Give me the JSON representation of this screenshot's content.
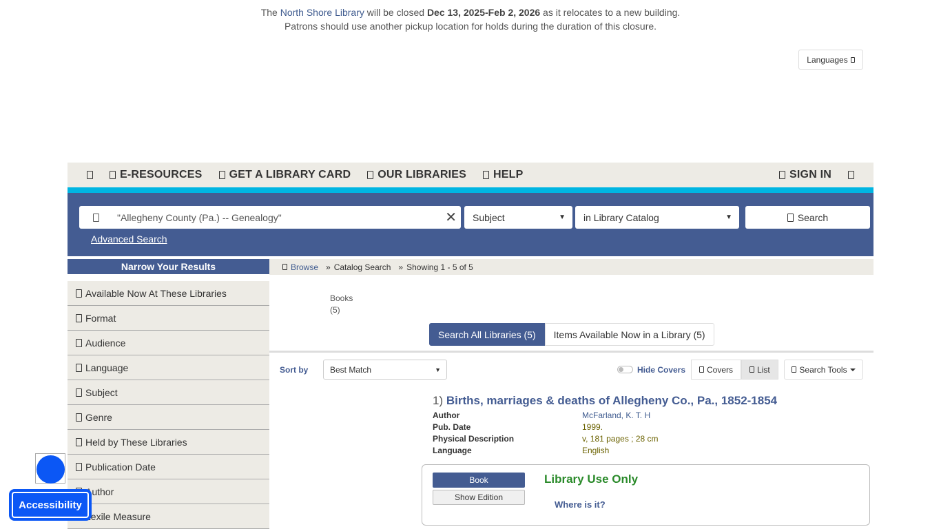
{
  "alert": {
    "line1_pre": "The ",
    "library_link": "North Shore Library",
    "line1_mid": " will be closed ",
    "dates": "Dec 13, 2025-Feb 2, 2026",
    "line1_post": " as it relocates to a new building.",
    "line2": "Patrons should use another pickup location for holds during the duration of this closure."
  },
  "languages_label": "Languages",
  "nav": {
    "items": [
      "E-RESOURCES",
      "GET A LIBRARY CARD",
      "OUR LIBRARIES",
      "HELP"
    ],
    "sign_in": "SIGN IN"
  },
  "search": {
    "query": "\"Allegheny County (Pa.) -- Genealogy\"",
    "clear": "✕",
    "type": "Subject",
    "scope": "in Library Catalog",
    "button": "Search",
    "advanced": "Advanced Search"
  },
  "sidebar": {
    "heading": "Narrow Your Results",
    "facets": [
      "Available Now At These Libraries",
      "Format",
      "Audience",
      "Language",
      "Subject",
      "Genre",
      "Held by These Libraries",
      "Publication Date",
      "Author",
      "Lexile Measure"
    ]
  },
  "breadcrumb": {
    "browse": "Browse",
    "sep1": "»",
    "catalog": "Catalog Search",
    "sep2": "»",
    "showing": "Showing 1 - 5 of 5"
  },
  "format_summary": {
    "label": "Books",
    "count": "(5)"
  },
  "tabs": {
    "all": "Search All Libraries (5)",
    "available": "Items Available Now in a Library (5)"
  },
  "toolbar": {
    "sort_label": "Sort by",
    "sort_value": "Best Match",
    "hide_covers": "Hide Covers",
    "covers": "Covers",
    "list": "List",
    "tools": "Search Tools"
  },
  "results": [
    {
      "number": "1)",
      "title": "Births, marriages & deaths of Allegheny Co., Pa., 1852-1854",
      "fields": [
        {
          "key": "Author",
          "value": "McFarland, K. T. H"
        },
        {
          "key": "Pub. Date",
          "value": "1999."
        },
        {
          "key": "Physical Description",
          "value": "v, 181 pages ; 28 cm"
        },
        {
          "key": "Language",
          "value": "English"
        }
      ],
      "format_button": "Book",
      "edition_button": "Show Edition",
      "status": "Library Use Only",
      "where": "Where is it?"
    }
  ],
  "accessibility_label": "Accessibility",
  "colors": {
    "brand_blue": "#445c92",
    "accent_cyan": "#00b5e2",
    "status_green": "#2a8a2a",
    "widget_blue": "#0b57f5"
  }
}
